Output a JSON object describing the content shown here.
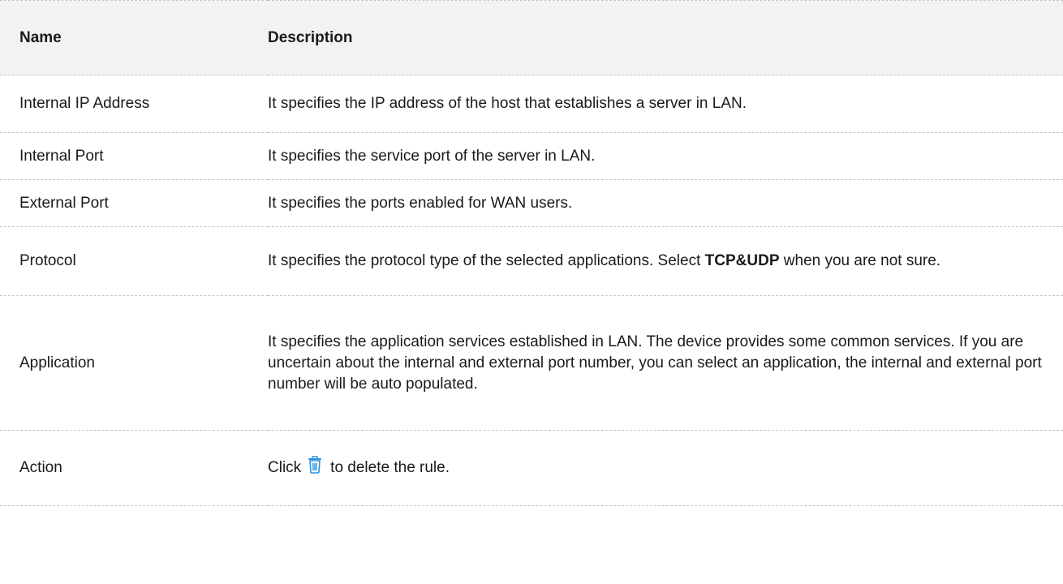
{
  "table": {
    "headers": {
      "name": "Name",
      "description": "Description"
    },
    "rows": [
      {
        "name": "Internal IP Address",
        "description": "It specifies the IP address of the host that establishes a server in LAN."
      },
      {
        "name": "Internal Port",
        "description": "It specifies the service port of the server in LAN."
      },
      {
        "name": "External Port",
        "description": "It specifies the ports enabled for WAN users."
      },
      {
        "name": "Protocol",
        "description_before": "It specifies the protocol type of the selected applications. Select ",
        "description_bold": "TCP&UDP",
        "description_after": " when you are not sure."
      },
      {
        "name": "Application",
        "description": "It specifies the application services established in LAN. The device provides some common services. If you are uncertain about the internal and external port number, you can select an application, the internal and external port number will be auto populated."
      },
      {
        "name": "Action",
        "description_before": "Click",
        "description_icon": "trash-icon",
        "description_after": "to delete the rule."
      }
    ]
  },
  "colors": {
    "header_background": "#f2f2f2",
    "divider": "#c6c6c6",
    "icon_blue": "#2f8fd8"
  }
}
